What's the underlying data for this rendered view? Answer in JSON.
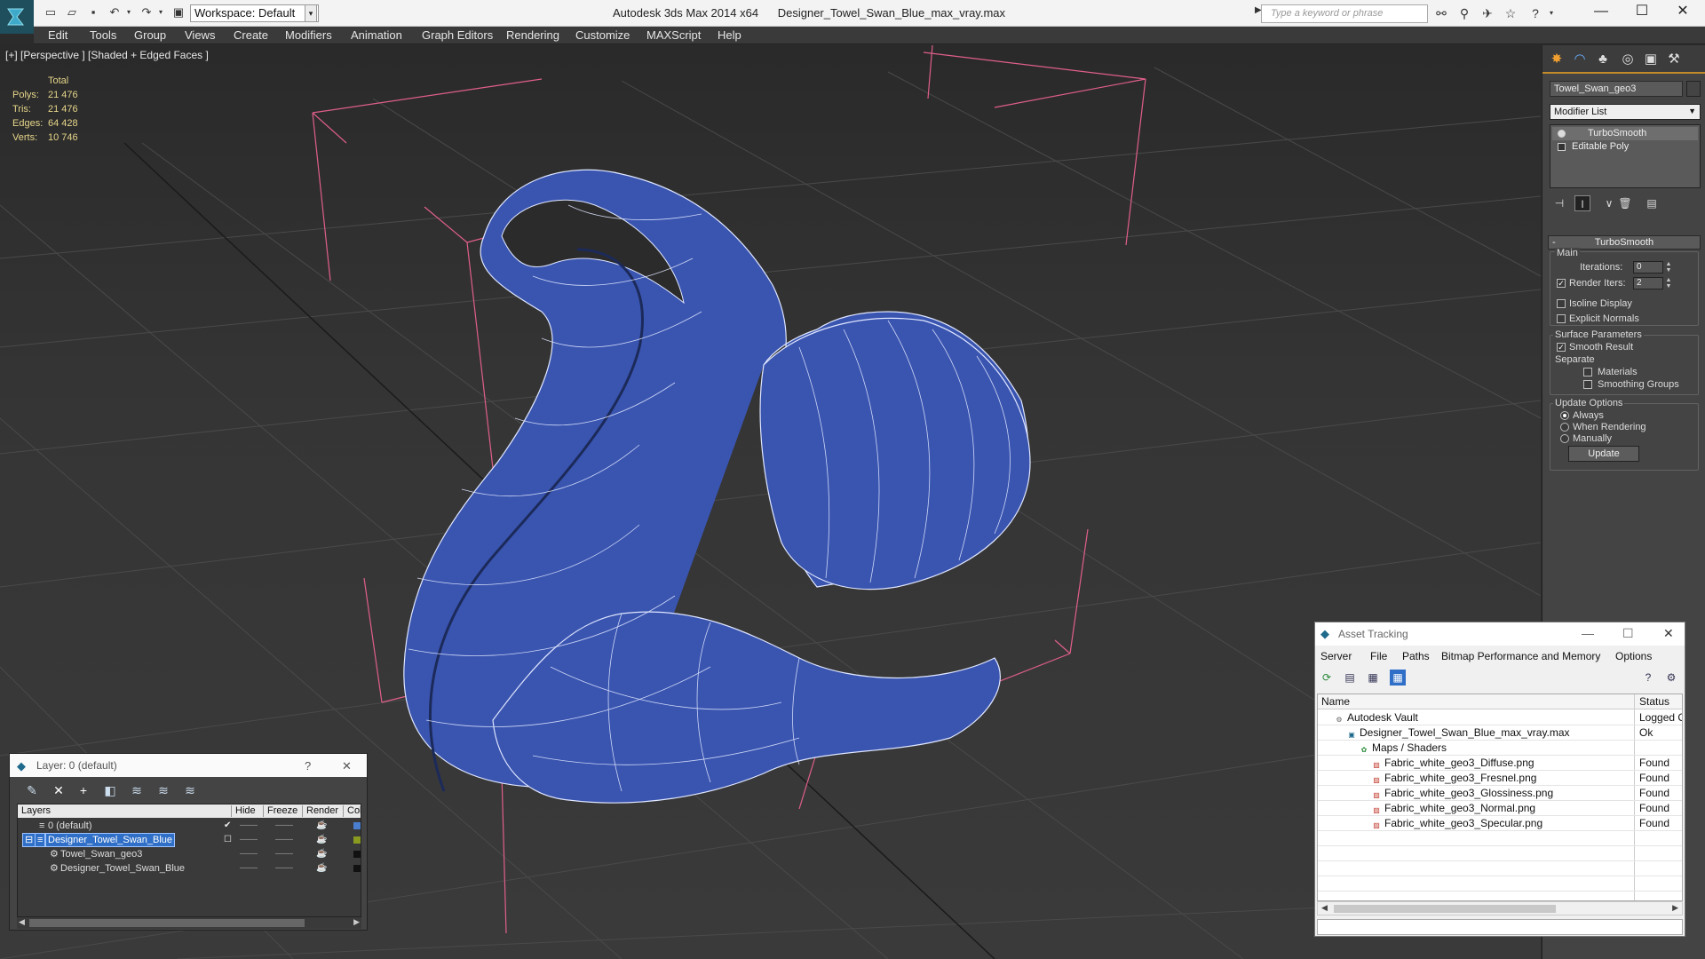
{
  "titlebar": {
    "workspace_label": "Workspace: Default",
    "app_name": "Autodesk 3ds Max  2014 x64",
    "file_name": "Designer_Towel_Swan_Blue_max_vray.max",
    "search_placeholder": "Type a keyword or phrase"
  },
  "menu": [
    "Edit",
    "Tools",
    "Group",
    "Views",
    "Create",
    "Modifiers",
    "Animation",
    "Graph Editors",
    "Rendering",
    "Customize",
    "MAXScript",
    "Help"
  ],
  "viewport": {
    "label": "[+] [Perspective ] [Shaded + Edged Faces ]",
    "stats": {
      "header": "Total",
      "rows": [
        {
          "label": "Polys:",
          "value": "21 476"
        },
        {
          "label": "Tris:",
          "value": "21 476"
        },
        {
          "label": "Edges:",
          "value": "64 428"
        },
        {
          "label": "Verts:",
          "value": "10 746"
        }
      ]
    },
    "object_color": "#3a55b0"
  },
  "command_panel": {
    "object_name": "Towel_Swan_geo3",
    "modifier_list": "Modifier List",
    "stack": [
      "TurboSmooth",
      "Editable Poly"
    ],
    "rollout_title": "TurboSmooth",
    "main_group": "Main",
    "iterations_label": "Iterations:",
    "iterations_value": "0",
    "render_iters_label": "Render Iters:",
    "render_iters_value": "2",
    "isoline_display": "Isoline Display",
    "explicit_normals": "Explicit Normals",
    "surface_params": "Surface Parameters",
    "smooth_result": "Smooth Result",
    "separate": "Separate",
    "materials": "Materials",
    "smoothing_groups": "Smoothing Groups",
    "update_options": "Update Options",
    "always": "Always",
    "when_rendering": "When Rendering",
    "manually": "Manually",
    "update_button": "Update"
  },
  "layer_window": {
    "title": "Layer: 0 (default)",
    "help": "?",
    "columns": [
      "Layers",
      "Hide",
      "Freeze",
      "Render",
      "Colo"
    ],
    "rows": [
      {
        "name": "0 (default)",
        "color": "#4a7fd0"
      },
      {
        "name": "Designer_Towel_Swan_Blue",
        "color": "#8a9a20"
      },
      {
        "name": "Towel_Swan_geo3",
        "color": "#111111"
      },
      {
        "name": "Designer_Towel_Swan_Blue",
        "color": "#111111"
      }
    ]
  },
  "asset_window": {
    "title": "Asset Tracking",
    "menu": [
      "Server",
      "File",
      "Paths",
      "Bitmap Performance and Memory",
      "Options"
    ],
    "columns": [
      "Name",
      "Status"
    ],
    "rows": [
      {
        "name": "Autodesk Vault",
        "status": "Logged O"
      },
      {
        "name": "Designer_Towel_Swan_Blue_max_vray.max",
        "status": "Ok"
      },
      {
        "name": "Maps / Shaders",
        "status": ""
      },
      {
        "name": "Fabric_white_geo3_Diffuse.png",
        "status": "Found"
      },
      {
        "name": "Fabric_white_geo3_Fresnel.png",
        "status": "Found"
      },
      {
        "name": "Fabric_white_geo3_Glossiness.png",
        "status": "Found"
      },
      {
        "name": "Fabric_white_geo3_Normal.png",
        "status": "Found"
      },
      {
        "name": "Fabric_white_geo3_Specular.png",
        "status": "Found"
      }
    ]
  }
}
